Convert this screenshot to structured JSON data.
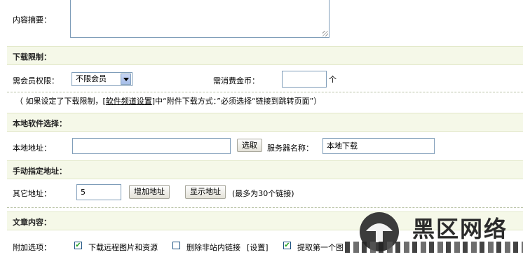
{
  "summary": {
    "label": "内容摘要：",
    "value": ""
  },
  "download_limit": {
    "title": "下载限制：",
    "member_label": "需会员权限：",
    "member_select": "不限会员",
    "gold_label": "需消费金币：",
    "gold_value": "",
    "gold_unit": "个",
    "note_prefix": "（ 如果设定了下载限制，[",
    "note_link": "软件频道设置",
    "note_suffix": "]中“附件下载方式：”必须选择“链接到跳转页面”）"
  },
  "local_software": {
    "title": "本地软件选择：",
    "address_label": "本地地址：",
    "address_value": "",
    "pick_button": "选取",
    "server_label": "服务器名称：",
    "server_value": "本地下载"
  },
  "manual_address": {
    "title": "手动指定地址：",
    "other_label": "其它地址：",
    "count_value": "5",
    "add_button": "增加地址",
    "show_button": "显示地址",
    "max_note": "(最多为30个链接)"
  },
  "article": {
    "title": "文章内容：",
    "options_label": "附加选项：",
    "options": [
      {
        "label": "下载远程图片和资源",
        "checked": true
      },
      {
        "label": "删除非站内链接",
        "checked": false
      },
      {
        "label": "[设置]",
        "checked": null
      },
      {
        "label": "提取第一个图",
        "checked": true
      }
    ]
  },
  "watermark": {
    "text": "黑区网络"
  },
  "colors": {
    "section_bg": "#f5f8e8",
    "input_border": "#7f9db9",
    "dash": "#b9c2a5"
  }
}
